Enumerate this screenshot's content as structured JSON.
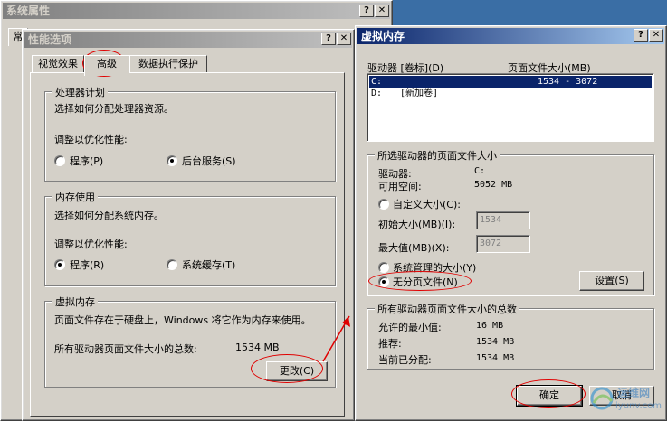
{
  "sysprops": {
    "title": "系统属性",
    "tab_partial": "常"
  },
  "perf": {
    "title": "性能选项",
    "tabs": [
      "视觉效果",
      "高级",
      "数据执行保护"
    ],
    "processor": {
      "legend": "处理器计划",
      "desc": "选择如何分配处理器资源。",
      "adjust": "调整以优化性能:",
      "opt1": "程序(P)",
      "opt2": "后台服务(S)"
    },
    "memory": {
      "legend": "内存使用",
      "desc": "选择如何分配系统内存。",
      "adjust": "调整以优化性能:",
      "opt1": "程序(R)",
      "opt2": "系统缓存(T)"
    },
    "vm": {
      "legend": "虚拟内存",
      "desc": "页面文件存在于硬盘上，Windows 将它作为内存来使用。",
      "total_label": "所有驱动器页面文件大小的总数:",
      "total_value": "1534 MB",
      "change_btn": "更改(C)"
    }
  },
  "vmem": {
    "title": "虚拟内存",
    "col_drive": "驱动器 [卷标](D)",
    "col_size": "页面文件大小(MB)",
    "drives": [
      {
        "drive": "C:",
        "label": "",
        "size": "1534 - 3072"
      },
      {
        "drive": "D:",
        "label": "[新加卷]",
        "size": ""
      }
    ],
    "selected": {
      "legend": "所选驱动器的页面文件大小",
      "drive_label": "驱动器:",
      "drive_value": "C:",
      "space_label": "可用空间:",
      "space_value": "5052 MB",
      "custom": "自定义大小(C):",
      "initial_label": "初始大小(MB)(I):",
      "initial_value": "1534",
      "max_label": "最大值(MB)(X):",
      "max_value": "3072",
      "system_managed": "系统管理的大小(Y)",
      "no_paging": "无分页文件(N)",
      "set_btn": "设置(S)"
    },
    "totals": {
      "legend": "所有驱动器页面文件大小的总数",
      "min_label": "允许的最小值:",
      "min_value": "16 MB",
      "rec_label": "推荐:",
      "rec_value": "1534 MB",
      "cur_label": "当前已分配:",
      "cur_value": "1534 MB"
    },
    "ok_btn": "确定",
    "cancel_btn": "取消"
  },
  "watermark": {
    "line1": "运维网",
    "line2": "iyunv.com"
  },
  "colors": {
    "annotation": "#e00000",
    "title_active": "#0a246a",
    "selection": "#0a246a"
  }
}
